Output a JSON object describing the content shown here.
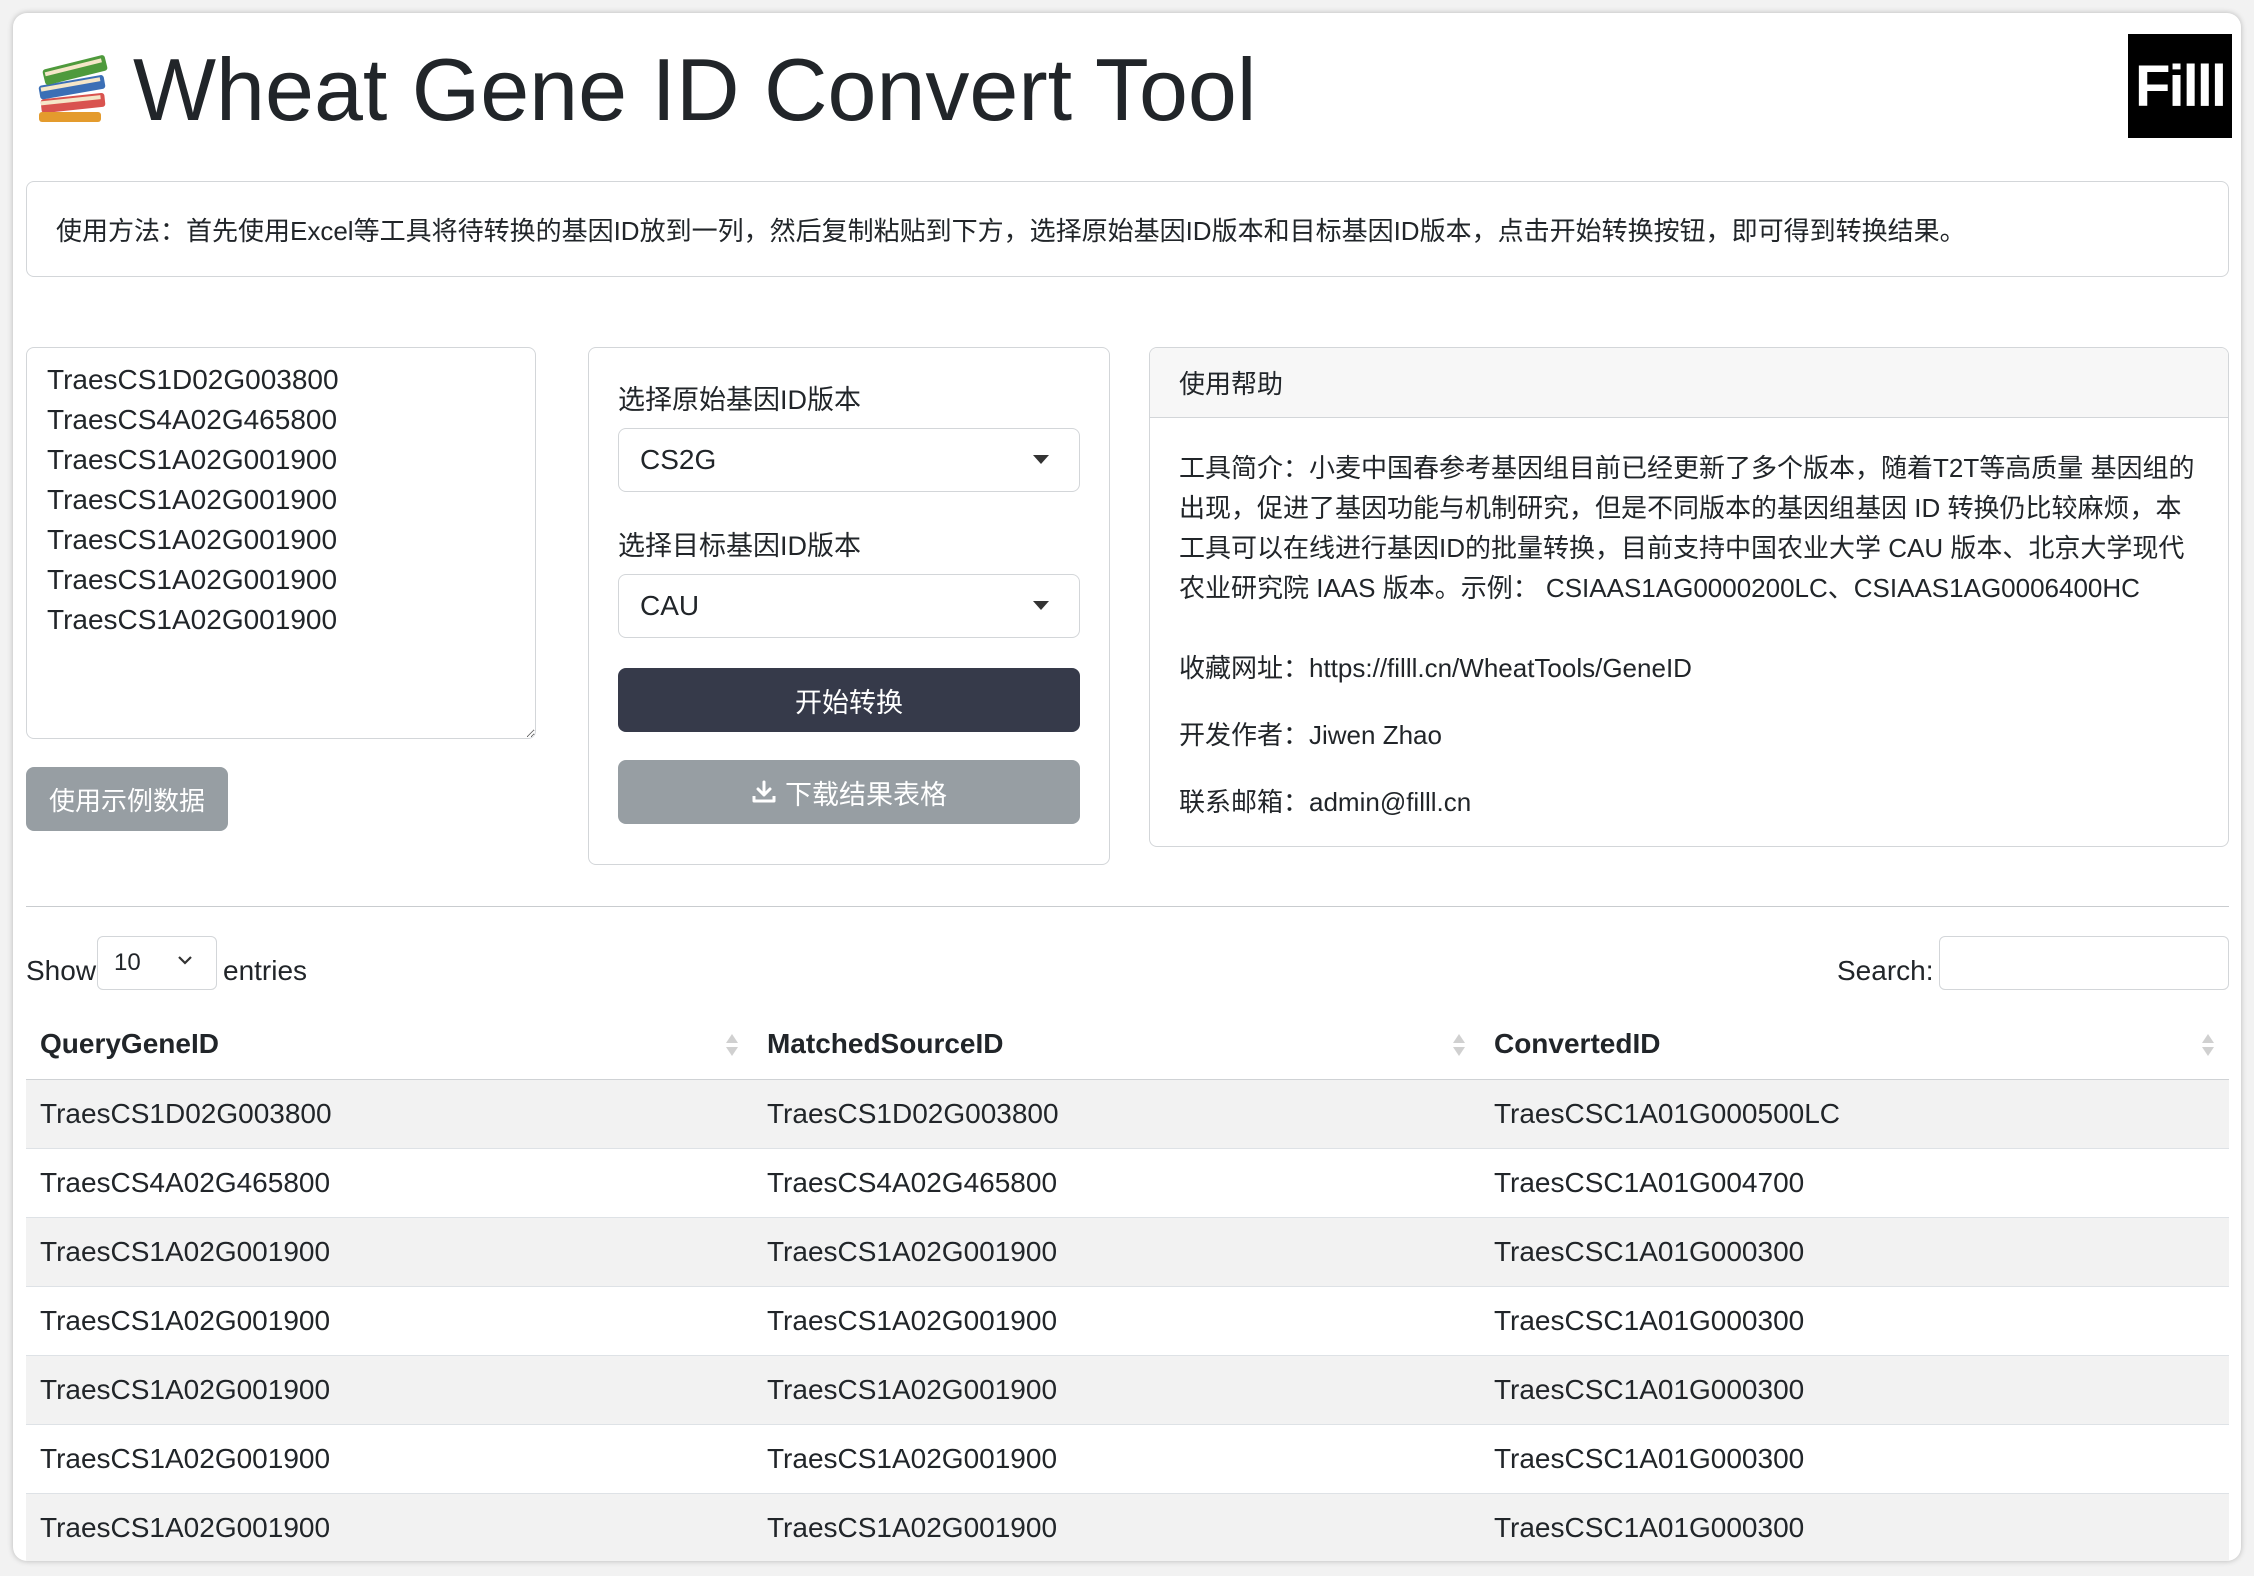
{
  "header": {
    "title": "Wheat Gene ID Convert Tool",
    "icon": "books-icon",
    "brand": "Filll"
  },
  "usage": {
    "text": "使用方法：首先使用Excel等工具将待转换的基因ID放到一列，然后复制粘贴到下方，选择原始基因ID版本和目标基因ID版本，点击开始转换按钮，即可得到转换结果。"
  },
  "input": {
    "value": "TraesCS1D02G003800\nTraesCS4A02G465800\nTraesCS1A02G001900\nTraesCS1A02G001900\nTraesCS1A02G001900\nTraesCS1A02G001900\nTraesCS1A02G001900",
    "example_button": "使用示例数据"
  },
  "convert": {
    "source_label": "选择原始基因ID版本",
    "source_value": "CS2G",
    "target_label": "选择目标基因ID版本",
    "target_value": "CAU",
    "start_button": "开始转换",
    "download_button": "下载结果表格"
  },
  "help": {
    "title": "使用帮助",
    "intro": "工具简介：小麦中国春参考基因组目前已经更新了多个版本，随着T2T等高质量 基因组的出现，促进了基因功能与机制研究，但是不同版本的基因组基因 ID 转换仍比较麻烦，本工具可以在线进行基因ID的批量转换，目前支持中国农业大学 CAU 版本、北京大学现代农业研究院 IAAS 版本。示例： CSIAAS1AG0000200LC、CSIAAS1AG0006400HC",
    "url_line": "收藏网址：https://filll.cn/WheatTools/GeneID",
    "author_line": "开发作者：Jiwen Zhao",
    "email_line": "联系邮箱：admin@filll.cn"
  },
  "table_controls": {
    "show_label": "Show",
    "length_value": "10",
    "entries_label": "entries",
    "search_label": "Search:"
  },
  "table": {
    "columns": [
      "QueryGeneID",
      "MatchedSourceID",
      "ConvertedID"
    ],
    "rows": [
      [
        "TraesCS1D02G003800",
        "TraesCS1D02G003800",
        "TraesCSC1A01G000500LC"
      ],
      [
        "TraesCS4A02G465800",
        "TraesCS4A02G465800",
        "TraesCSC1A01G004700"
      ],
      [
        "TraesCS1A02G001900",
        "TraesCS1A02G001900",
        "TraesCSC1A01G000300"
      ],
      [
        "TraesCS1A02G001900",
        "TraesCS1A02G001900",
        "TraesCSC1A01G000300"
      ],
      [
        "TraesCS1A02G001900",
        "TraesCS1A02G001900",
        "TraesCSC1A01G000300"
      ],
      [
        "TraesCS1A02G001900",
        "TraesCS1A02G001900",
        "TraesCSC1A01G000300"
      ],
      [
        "TraesCS1A02G001900",
        "TraesCS1A02G001900",
        "TraesCSC1A01G000300"
      ]
    ]
  },
  "colors": {
    "primary_button": "#363a4a",
    "secondary_button": "#979ea3",
    "stripe": "#f2f2f2"
  }
}
